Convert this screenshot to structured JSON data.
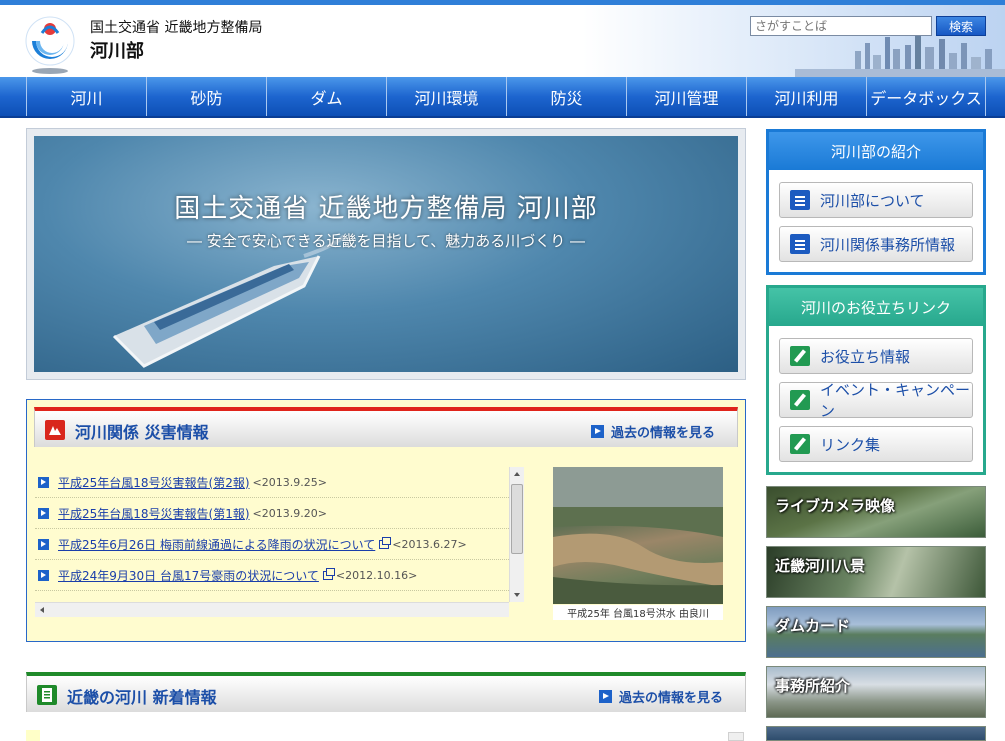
{
  "header": {
    "org_name": "国土交通省 近畿地方整備局",
    "dept_name": "河川部",
    "search_placeholder": "さがすことば",
    "search_button": "検索"
  },
  "nav": {
    "items": [
      "河川",
      "砂防",
      "ダム",
      "河川環境",
      "防災",
      "河川管理",
      "河川利用",
      "データボックス"
    ]
  },
  "hero": {
    "title": "国土交通省 近畿地方整備局 河川部",
    "subtitle": "― 安全で安心できる近畿を目指して、魅力ある川づくり ―"
  },
  "disaster": {
    "title": "河川関係 災害情報",
    "past_link": "過去の情報を見る",
    "items": [
      {
        "text": "平成25年台風18号災害報告(第2報)",
        "date": "<2013.9.25>",
        "external": false
      },
      {
        "text": "平成25年台風18号災害報告(第1報)",
        "date": "<2013.9.20>",
        "external": false
      },
      {
        "text": "平成25年6月26日 梅雨前線通過による降雨の状況について",
        "date": "<2013.6.27>",
        "external": true
      },
      {
        "text": "平成24年9月30日 台風17号豪雨の状況について",
        "date": "<2012.10.16>",
        "external": true
      }
    ],
    "photo_caption": "平成25年 台風18号洪水 由良川"
  },
  "news": {
    "title": "近畿の河川 新着情報",
    "past_link": "過去の情報を見る"
  },
  "intro": {
    "title": "河川部の紹介",
    "buttons": [
      "河川部について",
      "河川関係事務所情報"
    ]
  },
  "links": {
    "title": "河川のお役立ちリンク",
    "buttons": [
      "お役立ち情報",
      "イベント・キャンペーン",
      "リンク集"
    ]
  },
  "banners": {
    "camera": "ライブカメラ映像",
    "eight_views": "近畿河川八景",
    "dam_card": "ダムカード",
    "office": "事務所紹介"
  },
  "colors": {
    "nav_blue": "#1d65cf",
    "disaster_accent": "#e0251b",
    "news_accent": "#1f8a2a",
    "intro_border": "#1a7ad6",
    "links_border": "#27a88d",
    "link_text": "#1a3eaa"
  }
}
